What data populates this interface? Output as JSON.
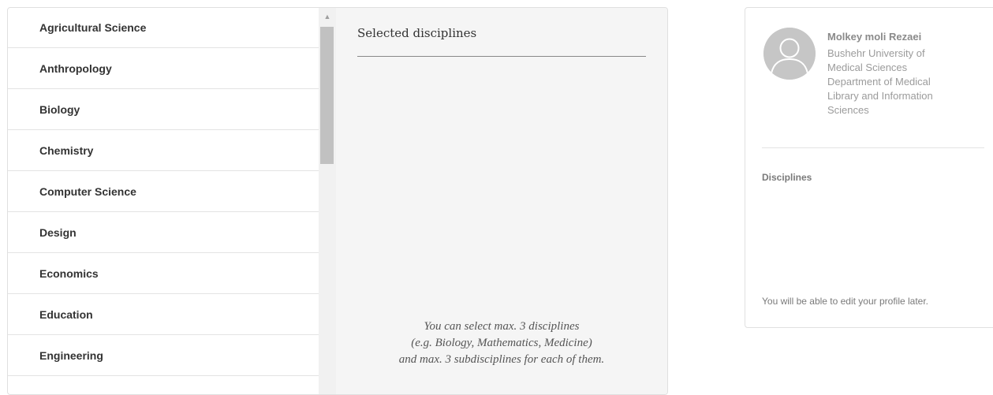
{
  "disciplines": [
    "Agricultural Science",
    "Anthropology",
    "Biology",
    "Chemistry",
    "Computer Science",
    "Design",
    "Economics",
    "Education",
    "Engineering"
  ],
  "selected_panel": {
    "title": "Selected disciplines",
    "hint_line1": "You can select max. 3 disciplines",
    "hint_line2": "(e.g. Biology, Mathematics, Medicine)",
    "hint_line3": "and max. 3 subdisciplines for each of them."
  },
  "profile": {
    "name": "Molkey moli Rezaei",
    "affiliation_lines": [
      "Bushehr University of",
      "Medical Sciences",
      "Department of Medical",
      "Library and Information",
      "Sciences"
    ],
    "disciplines_label": "Disciplines",
    "edit_note": "You will be able to edit your profile later."
  },
  "colors": {
    "panel_background": "#f5f5f5",
    "scroll_thumb": "#c1c1c1",
    "avatar": "#c6c6c6"
  }
}
